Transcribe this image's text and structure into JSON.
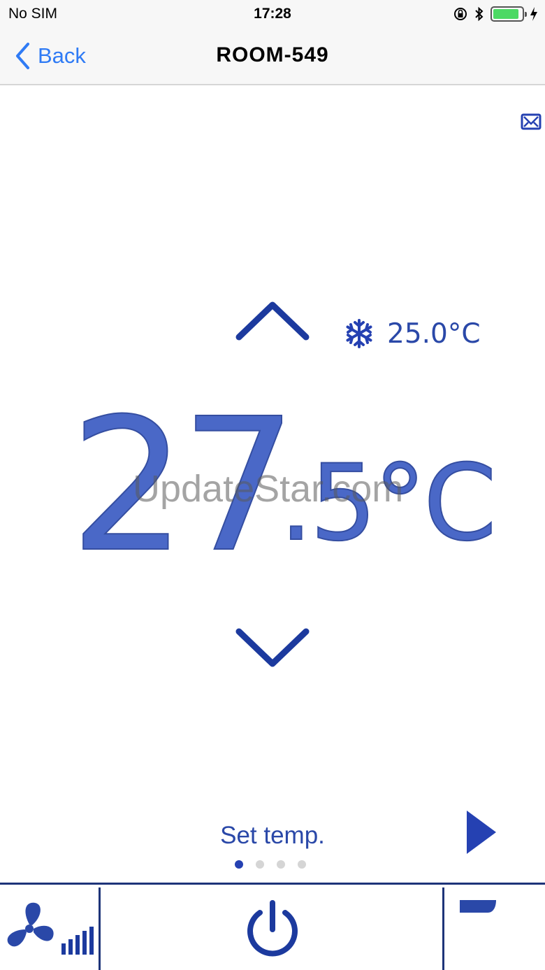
{
  "status_bar": {
    "carrier": "No SIM",
    "time": "17:28",
    "battery_level": 0.9,
    "battery_color": "#4cd964"
  },
  "nav": {
    "back_label": "Back",
    "title": "ROOM-549"
  },
  "mode": {
    "icon": "snowflake-icon",
    "current_temp": "25.0°C"
  },
  "setpoint": {
    "integer": "27",
    "decimal": ".5°C",
    "label": "Set temp."
  },
  "watermark": "UpdateStar.com",
  "pager": {
    "count": 4,
    "active_index": 0
  },
  "toolbar": {
    "fan_icon": "fan-speed-icon",
    "power_icon": "power-icon",
    "minus_icon": "minus-icon"
  },
  "colors": {
    "accent": "#2a48a8",
    "link": "#2f7bf5",
    "divider": "#1e3479"
  }
}
